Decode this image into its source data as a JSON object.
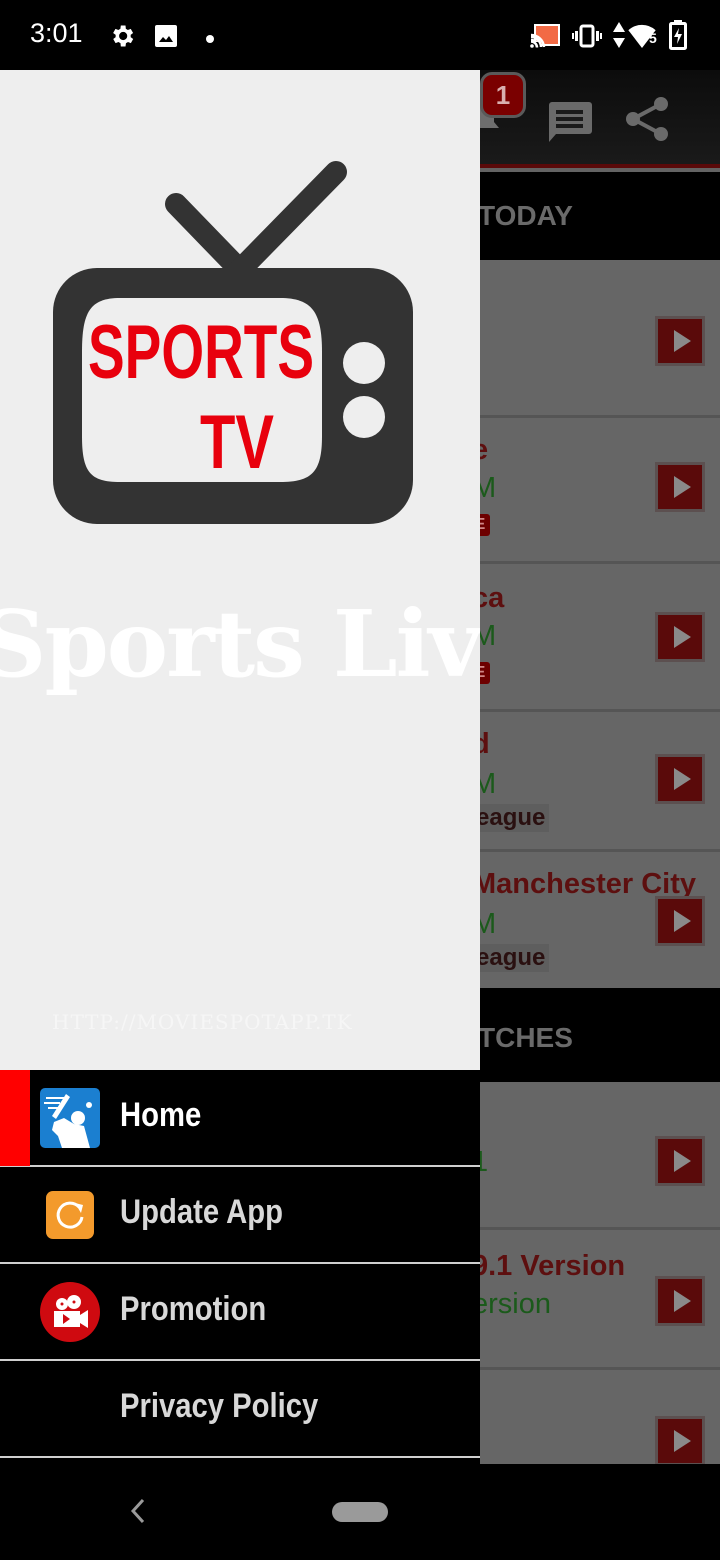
{
  "status_bar": {
    "time": "3:01",
    "left_icons": [
      "settings-icon",
      "image-icon",
      "dot-icon"
    ],
    "right_icons": [
      "cast-icon",
      "vibrate-icon",
      "data-arrows-icon",
      "wifi-icon",
      "battery-charging-icon"
    ],
    "wifi_label": "5",
    "cast_color": "#f26a45"
  },
  "app": {
    "notification_count": "1",
    "toolbar_icons": [
      "notification-icon",
      "chat-icon",
      "share-icon"
    ],
    "sections": [
      {
        "header": "TODAY",
        "matches": [
          {
            "title": "",
            "time": "",
            "league": "",
            "live": false
          },
          {
            "title": "e",
            "time": "M",
            "league": "",
            "live": true,
            "live_label": "E"
          },
          {
            "title": "ca",
            "time": "M",
            "league": "",
            "live": true,
            "live_label": "E"
          },
          {
            "title": "d",
            "time": "M",
            "league": "eague",
            "live": false
          },
          {
            "title": "Manchester City",
            "time": "M",
            "league": "eague",
            "live": false
          }
        ]
      },
      {
        "header": "TCHES",
        "matches": [
          {
            "title": "",
            "time": "1",
            "league": ""
          },
          {
            "title": "9.1 Version",
            "time": "ersion",
            "league": ""
          },
          {
            "title": "",
            "time": "",
            "league": ""
          }
        ]
      }
    ],
    "accent_color": "#7a0000"
  },
  "drawer": {
    "logo": {
      "line1": "SPORTS",
      "line2": "TV",
      "text_color": "#e8000d",
      "tv_color": "#333333"
    },
    "brand_title": "Sports Live Tv",
    "brand_url": "HTTP://MOVIESPOTAPP.TK",
    "menu": [
      {
        "label": "Home",
        "icon": "cricket-icon",
        "active": true
      },
      {
        "label": "Update App",
        "icon": "refresh-icon",
        "active": false
      },
      {
        "label": "Promotion",
        "icon": "video-camera-icon",
        "active": false
      },
      {
        "label": "Privacy Policy",
        "icon": "",
        "active": false
      }
    ],
    "active_color": "#ff0000"
  },
  "nav_bar": {
    "buttons": [
      "back-button",
      "home-button"
    ]
  }
}
